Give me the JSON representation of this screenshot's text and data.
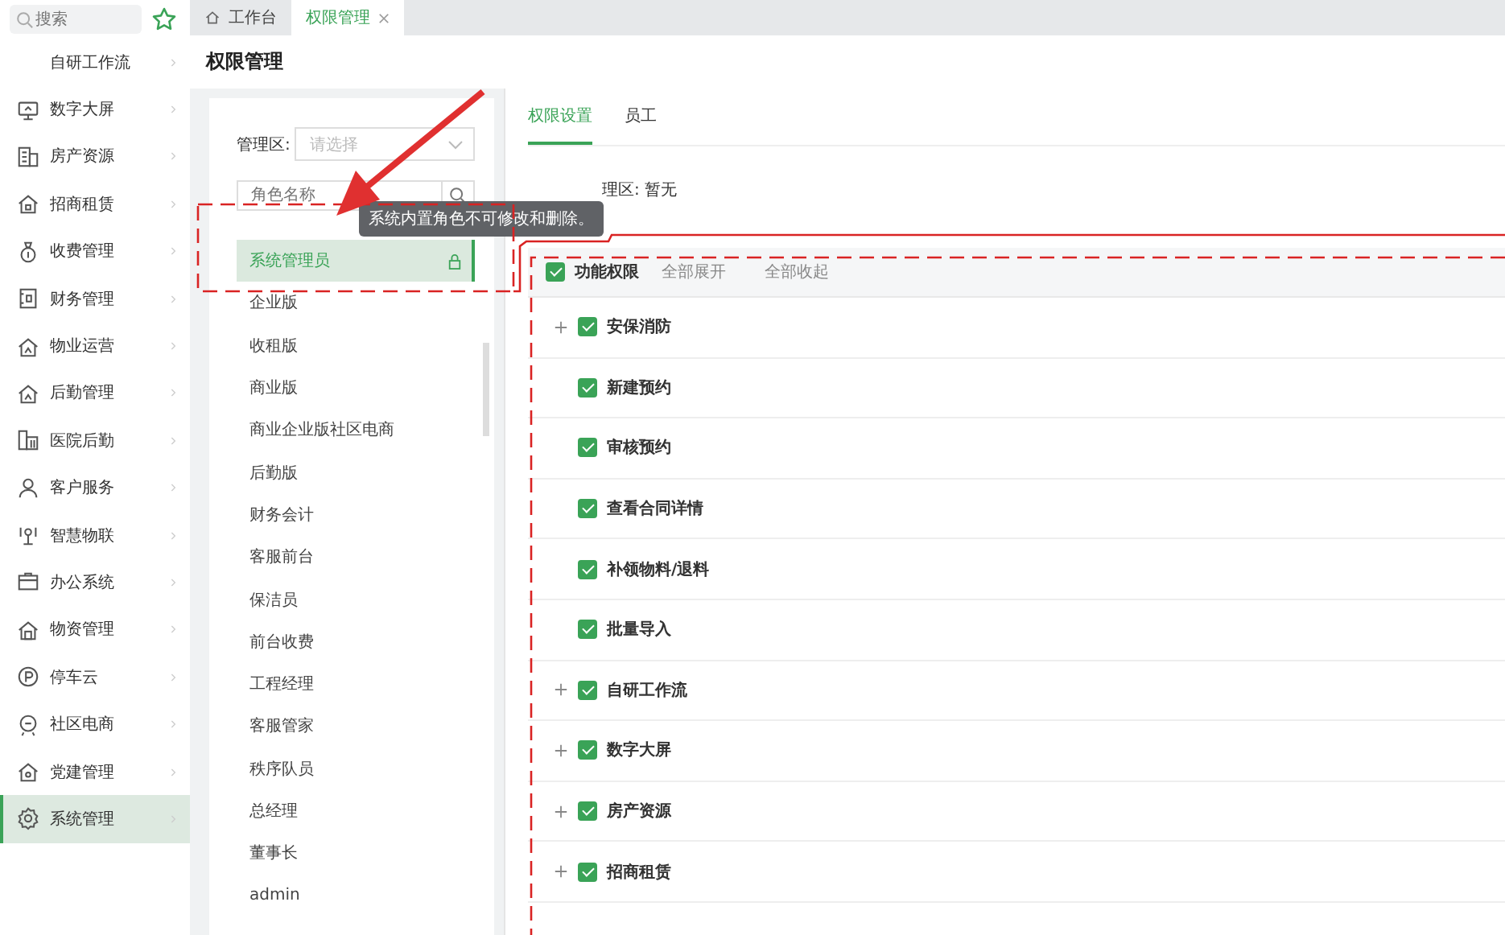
{
  "sidebar": {
    "search": {
      "placeholder": "搜索"
    },
    "items": [
      {
        "label": "自研工作流",
        "selected": false
      },
      {
        "label": "数字大屏",
        "selected": false
      },
      {
        "label": "房产资源",
        "selected": false
      },
      {
        "label": "招商租赁",
        "selected": false
      },
      {
        "label": "收费管理",
        "selected": false
      },
      {
        "label": "财务管理",
        "selected": false
      },
      {
        "label": "物业运营",
        "selected": false
      },
      {
        "label": "后勤管理",
        "selected": false
      },
      {
        "label": "医院后勤",
        "selected": false
      },
      {
        "label": "客户服务",
        "selected": false
      },
      {
        "label": "智慧物联",
        "selected": false
      },
      {
        "label": "办公系统",
        "selected": false
      },
      {
        "label": "物资管理",
        "selected": false
      },
      {
        "label": "停车云",
        "selected": false
      },
      {
        "label": "社区电商",
        "selected": false
      },
      {
        "label": "党建管理",
        "selected": false
      },
      {
        "label": "系统管理",
        "selected": true
      }
    ]
  },
  "tabs": [
    {
      "label": "工作台",
      "selected": false,
      "closable": false
    },
    {
      "label": "权限管理",
      "selected": true,
      "closable": true
    }
  ],
  "page_title": "权限管理",
  "roles_panel": {
    "area_label": "管理区:",
    "area_select": {
      "placeholder": "请选择"
    },
    "search": {
      "placeholder": "角色名称"
    },
    "roles": [
      {
        "name": "系统管理员",
        "selected": true,
        "locked": true
      },
      {
        "name": "企业版",
        "selected": false,
        "locked": false
      },
      {
        "name": "收租版",
        "selected": false,
        "locked": false
      },
      {
        "name": "商业版",
        "selected": false,
        "locked": false
      },
      {
        "name": "商业企业版社区电商",
        "selected": false,
        "locked": false
      },
      {
        "name": "后勤版",
        "selected": false,
        "locked": false
      },
      {
        "name": "财务会计",
        "selected": false,
        "locked": false
      },
      {
        "name": "客服前台",
        "selected": false,
        "locked": false
      },
      {
        "name": "保洁员",
        "selected": false,
        "locked": false
      },
      {
        "name": "前台收费",
        "selected": false,
        "locked": false
      },
      {
        "name": "工程经理",
        "selected": false,
        "locked": false
      },
      {
        "name": "客服管家",
        "selected": false,
        "locked": false
      },
      {
        "name": "秩序队员",
        "selected": false,
        "locked": false
      },
      {
        "name": "总经理",
        "selected": false,
        "locked": false
      },
      {
        "name": "董事长",
        "selected": false,
        "locked": false
      },
      {
        "name": "admin",
        "selected": false,
        "locked": false
      }
    ]
  },
  "tooltip": "系统内置角色不可修改和删除。",
  "detail": {
    "tabs": [
      {
        "label": "权限设置",
        "selected": true
      },
      {
        "label": "员工",
        "selected": false
      }
    ],
    "area_text": "理区: 暂无",
    "tree_header": {
      "label": "功能权限",
      "checked": true,
      "actions": [
        "全部展开",
        "全部收起"
      ]
    },
    "tree": [
      {
        "label": "安保消防",
        "checked": true,
        "expandable": true
      },
      {
        "label": "新建预约",
        "checked": true,
        "expandable": false
      },
      {
        "label": "审核预约",
        "checked": true,
        "expandable": false
      },
      {
        "label": "查看合同详情",
        "checked": true,
        "expandable": false
      },
      {
        "label": "补领物料/退料",
        "checked": true,
        "expandable": false
      },
      {
        "label": "批量导入",
        "checked": true,
        "expandable": false
      },
      {
        "label": "自研工作流",
        "checked": true,
        "expandable": true
      },
      {
        "label": "数字大屏",
        "checked": true,
        "expandable": true
      },
      {
        "label": "房产资源",
        "checked": true,
        "expandable": true
      },
      {
        "label": "招商租赁",
        "checked": true,
        "expandable": true
      }
    ]
  }
}
